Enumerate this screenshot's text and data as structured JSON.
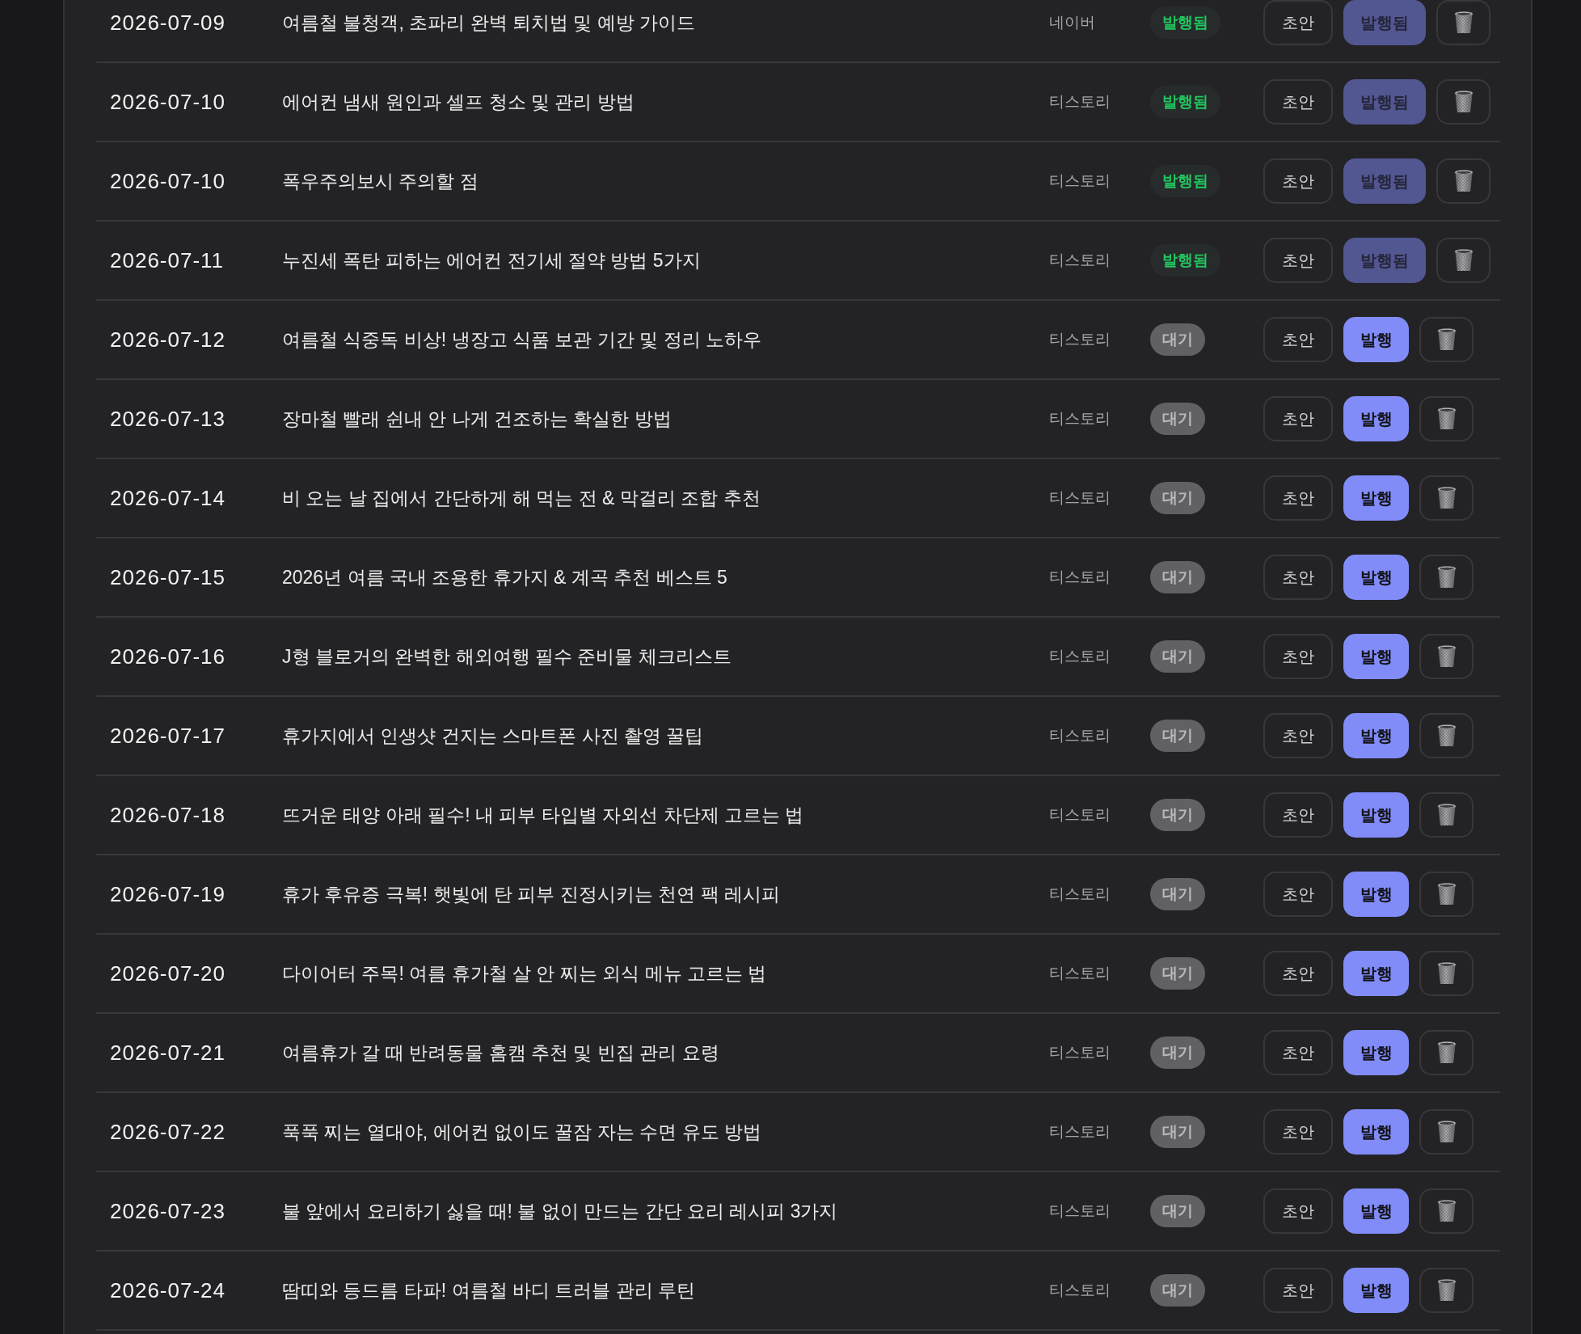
{
  "posts": [
    {
      "date": "2026-07-09",
      "title": "여름철 불청객, 초파리 완벽 퇴치법 및 예방 가이드",
      "platform": "네이버",
      "status": {
        "label": "발행됨",
        "kind": "published"
      },
      "draft_button": "초안",
      "publish_button": {
        "label": "발행됨",
        "disabled": true
      }
    },
    {
      "date": "2026-07-10",
      "title": "에어컨 냄새 원인과 셀프 청소 및 관리 방법",
      "platform": "티스토리",
      "status": {
        "label": "발행됨",
        "kind": "published"
      },
      "draft_button": "초안",
      "publish_button": {
        "label": "발행됨",
        "disabled": true
      }
    },
    {
      "date": "2026-07-10",
      "title": "폭우주의보시 주의할 점",
      "platform": "티스토리",
      "status": {
        "label": "발행됨",
        "kind": "published"
      },
      "draft_button": "초안",
      "publish_button": {
        "label": "발행됨",
        "disabled": true
      }
    },
    {
      "date": "2026-07-11",
      "title": "누진세 폭탄 피하는 에어컨 전기세 절약 방법 5가지",
      "platform": "티스토리",
      "status": {
        "label": "발행됨",
        "kind": "published"
      },
      "draft_button": "초안",
      "publish_button": {
        "label": "발행됨",
        "disabled": true
      }
    },
    {
      "date": "2026-07-12",
      "title": "여름철 식중독 비상! 냉장고 식품 보관 기간 및 정리 노하우",
      "platform": "티스토리",
      "status": {
        "label": "대기",
        "kind": "pending"
      },
      "draft_button": "초안",
      "publish_button": {
        "label": "발행",
        "disabled": false
      }
    },
    {
      "date": "2026-07-13",
      "title": "장마철 빨래 쉰내 안 나게 건조하는 확실한 방법",
      "platform": "티스토리",
      "status": {
        "label": "대기",
        "kind": "pending"
      },
      "draft_button": "초안",
      "publish_button": {
        "label": "발행",
        "disabled": false
      }
    },
    {
      "date": "2026-07-14",
      "title": "비 오는 날 집에서 간단하게 해 먹는 전 & 막걸리 조합 추천",
      "platform": "티스토리",
      "status": {
        "label": "대기",
        "kind": "pending"
      },
      "draft_button": "초안",
      "publish_button": {
        "label": "발행",
        "disabled": false
      }
    },
    {
      "date": "2026-07-15",
      "title": "2026년 여름 국내 조용한 휴가지 & 계곡 추천 베스트 5",
      "platform": "티스토리",
      "status": {
        "label": "대기",
        "kind": "pending"
      },
      "draft_button": "초안",
      "publish_button": {
        "label": "발행",
        "disabled": false
      }
    },
    {
      "date": "2026-07-16",
      "title": "J형 블로거의 완벽한 해외여행 필수 준비물 체크리스트",
      "platform": "티스토리",
      "status": {
        "label": "대기",
        "kind": "pending"
      },
      "draft_button": "초안",
      "publish_button": {
        "label": "발행",
        "disabled": false
      }
    },
    {
      "date": "2026-07-17",
      "title": "휴가지에서 인생샷 건지는 스마트폰 사진 촬영 꿀팁",
      "platform": "티스토리",
      "status": {
        "label": "대기",
        "kind": "pending"
      },
      "draft_button": "초안",
      "publish_button": {
        "label": "발행",
        "disabled": false
      }
    },
    {
      "date": "2026-07-18",
      "title": "뜨거운 태양 아래 필수! 내 피부 타입별 자외선 차단제 고르는 법",
      "platform": "티스토리",
      "status": {
        "label": "대기",
        "kind": "pending"
      },
      "draft_button": "초안",
      "publish_button": {
        "label": "발행",
        "disabled": false
      }
    },
    {
      "date": "2026-07-19",
      "title": "휴가 후유증 극복! 햇빛에 탄 피부 진정시키는 천연 팩 레시피",
      "platform": "티스토리",
      "status": {
        "label": "대기",
        "kind": "pending"
      },
      "draft_button": "초안",
      "publish_button": {
        "label": "발행",
        "disabled": false
      }
    },
    {
      "date": "2026-07-20",
      "title": "다이어터 주목! 여름 휴가철 살 안 찌는 외식 메뉴 고르는 법",
      "platform": "티스토리",
      "status": {
        "label": "대기",
        "kind": "pending"
      },
      "draft_button": "초안",
      "publish_button": {
        "label": "발행",
        "disabled": false
      }
    },
    {
      "date": "2026-07-21",
      "title": "여름휴가 갈 때 반려동물 홈캠 추천 및 빈집 관리 요령",
      "platform": "티스토리",
      "status": {
        "label": "대기",
        "kind": "pending"
      },
      "draft_button": "초안",
      "publish_button": {
        "label": "발행",
        "disabled": false
      }
    },
    {
      "date": "2026-07-22",
      "title": "푹푹 찌는 열대야, 에어컨 없이도 꿀잠 자는 수면 유도 방법",
      "platform": "티스토리",
      "status": {
        "label": "대기",
        "kind": "pending"
      },
      "draft_button": "초안",
      "publish_button": {
        "label": "발행",
        "disabled": false
      }
    },
    {
      "date": "2026-07-23",
      "title": "불 앞에서 요리하기 싫을 때! 불 없이 만드는 간단 요리 레시피 3가지",
      "platform": "티스토리",
      "status": {
        "label": "대기",
        "kind": "pending"
      },
      "draft_button": "초안",
      "publish_button": {
        "label": "발행",
        "disabled": false
      }
    },
    {
      "date": "2026-07-24",
      "title": "땀띠와 등드름 타파! 여름철 바디 트러블 관리 루틴",
      "platform": "티스토리",
      "status": {
        "label": "대기",
        "kind": "pending"
      },
      "draft_button": "초안",
      "publish_button": {
        "label": "발행",
        "disabled": false
      }
    }
  ]
}
